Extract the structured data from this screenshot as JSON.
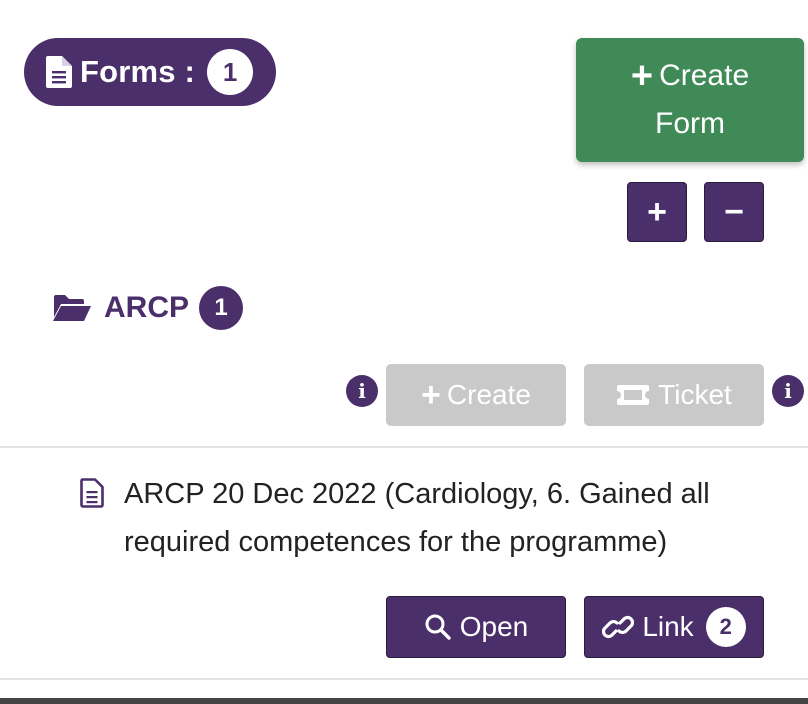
{
  "forms_header": {
    "label": "Forms :",
    "count": "1"
  },
  "create_form_button": {
    "line1": "Create",
    "line2": "Form"
  },
  "controls": {
    "expand_label": "+",
    "collapse_label": "−"
  },
  "folder": {
    "name": "ARCP",
    "count": "1"
  },
  "folder_actions": {
    "create_label": "Create",
    "ticket_label": "Ticket",
    "info_glyph": "i"
  },
  "form_item": {
    "title": "ARCP 20 Dec 2022 (Cardiology, 6. Gained all required competences for the programme)",
    "open_label": "Open",
    "link_label": "Link",
    "link_count": "2"
  },
  "colors": {
    "accent": "#4a2f6b",
    "success": "#3f8a57",
    "disabled": "#c9c9c9"
  },
  "icons": [
    "file-icon",
    "plus-icon",
    "folder-open-icon",
    "info-icon",
    "ticket-icon",
    "file-lines-icon",
    "search-icon",
    "link-icon"
  ]
}
